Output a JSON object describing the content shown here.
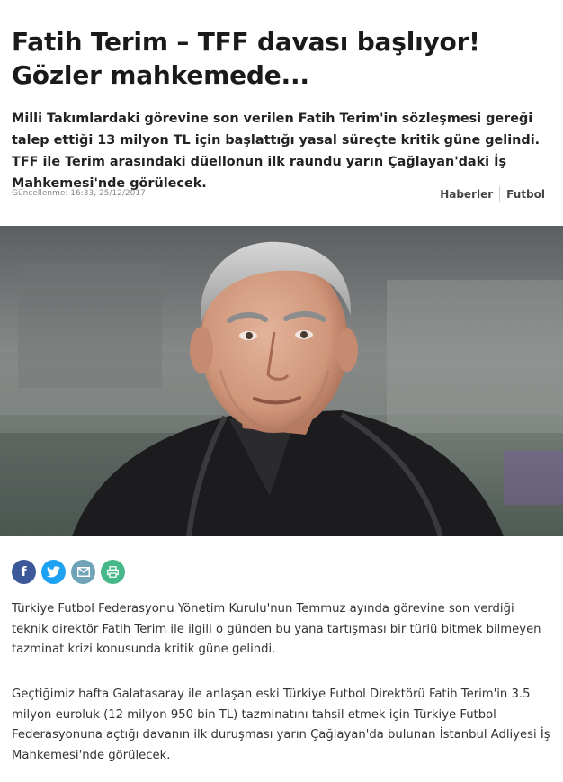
{
  "article": {
    "title": "Fatih Terim – TFF davası başlıyor! Gözler mahkemede...",
    "lead": "Milli Takımlardaki görevine son verilen Fatih Terim'in sözleşmesi gereği talep ettiği 13 milyon TL için başlattığı yasal süreçte kritik güne gelindi. TFF ile Terim arasındaki düellonun ilk raundu yarın Çağlayan'daki İş Mahkemesi'nde görülecek.",
    "updated": "Güncellenme: 16:33, 25/12/2017",
    "categories": [
      "Haberler",
      "Futbol"
    ],
    "paragraphs": [
      "Türkiye Futbol Federasyonu Yönetim Kurulu'nun Temmuz ayında görevine son verdiği teknik direktör Fatih Terim ile ilgili o günden bu yana tartışması bir türlü bitmek bilmeyen tazminat krizi konusunda kritik güne gelindi.",
      "Geçtiğimiz hafta Galatasaray ile anlaşan eski Türkiye Futbol Direktörü Fatih Terim'in 3.5 milyon euroluk (12 milyon 950 bin TL) tazminatını tahsil etmek için Türkiye Futbol Federasyonuna açtığı davanın ilk duruşması yarın Çağlayan'da bulunan İstanbul Adliyesi İş Mahkemesi'nde görülecek."
    ]
  },
  "share": {
    "icons": [
      "facebook-icon",
      "twitter-icon",
      "mail-icon",
      "print-icon"
    ],
    "colors": {
      "facebook": "#3b5998",
      "twitter": "#1da1f2",
      "mail": "#6fa4b8",
      "print": "#46b788"
    }
  }
}
